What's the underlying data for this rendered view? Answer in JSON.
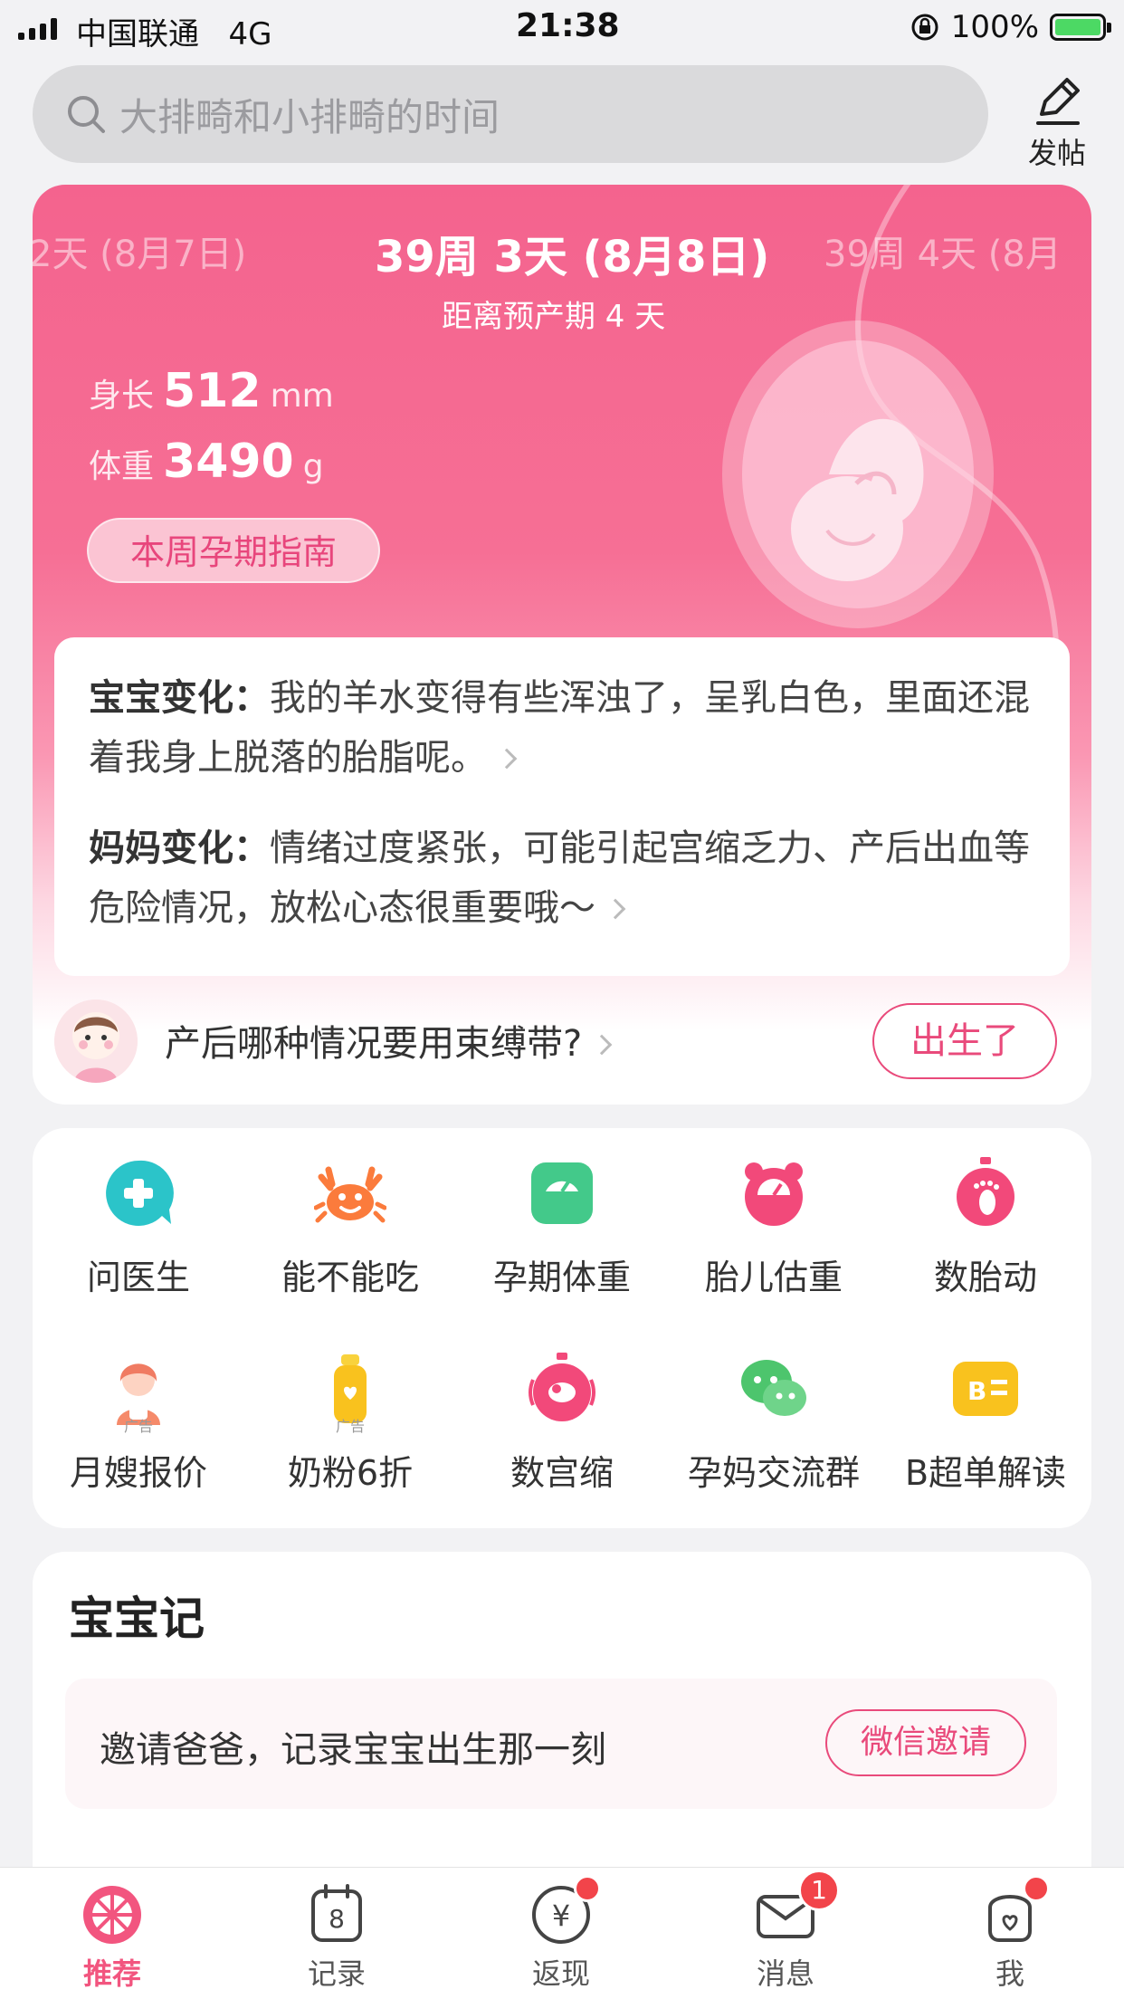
{
  "status_bar": {
    "carrier": "中国联通",
    "network": "4G",
    "time": "21:38",
    "battery": "100%"
  },
  "search": {
    "placeholder": "大排畸和小排畸的时间"
  },
  "post_button": {
    "label": "发帖"
  },
  "pregnancy": {
    "prev_date": "2天 (8月7日)",
    "current_date": "39周 3天 (8月8日)",
    "next_date": "39周 4天 (8月",
    "due_countdown": "距离预产期 4 天",
    "length_label": "身长",
    "length_value": "512",
    "length_unit": "mm",
    "weight_label": "体重",
    "weight_value": "3490",
    "weight_unit": "g",
    "guide_button": "本周孕期指南"
  },
  "changes": {
    "baby_label": "宝宝变化：",
    "baby_text": "我的羊水变得有些浑浊了，呈乳白色，里面还混着我身上脱落的胎脂呢。",
    "mom_label": "妈妈变化：",
    "mom_text": "情绪过度紧张，可能引起宫缩乏力、产后出血等危险情况，放松心态很重要哦～"
  },
  "tip": {
    "text": "产后哪种情况要用束缚带?",
    "born_button": "出生了"
  },
  "tools": [
    {
      "label": "问医生",
      "icon": "ask-doctor-icon"
    },
    {
      "label": "能不能吃",
      "icon": "crab-icon"
    },
    {
      "label": "孕期体重",
      "icon": "scale-icon"
    },
    {
      "label": "胎儿估重",
      "icon": "fetal-weight-icon"
    },
    {
      "label": "数胎动",
      "icon": "footprint-stopwatch-icon"
    },
    {
      "label": "月嫂报价",
      "icon": "nanny-icon",
      "ad": "广告"
    },
    {
      "label": "奶粉6折",
      "icon": "milk-bottle-icon",
      "ad": "广告"
    },
    {
      "label": "数宫缩",
      "icon": "contraction-timer-icon"
    },
    {
      "label": "孕妈交流群",
      "icon": "wechat-group-icon"
    },
    {
      "label": "B超单解读",
      "icon": "ultrasound-icon"
    }
  ],
  "baby_diary": {
    "title": "宝宝记",
    "invite_text": "邀请爸爸，记录宝宝出生那一刻",
    "invite_button": "微信邀请"
  },
  "tabbar": [
    {
      "label": "推荐",
      "active": true
    },
    {
      "label": "记录",
      "calendar_day": "8"
    },
    {
      "label": "返现",
      "currency": "¥"
    },
    {
      "label": "消息",
      "badge": "1"
    },
    {
      "label": "我"
    }
  ],
  "colors": {
    "accent": "#f2557f",
    "hero_pink": "#f4638e",
    "badge_red": "#f2444a"
  }
}
